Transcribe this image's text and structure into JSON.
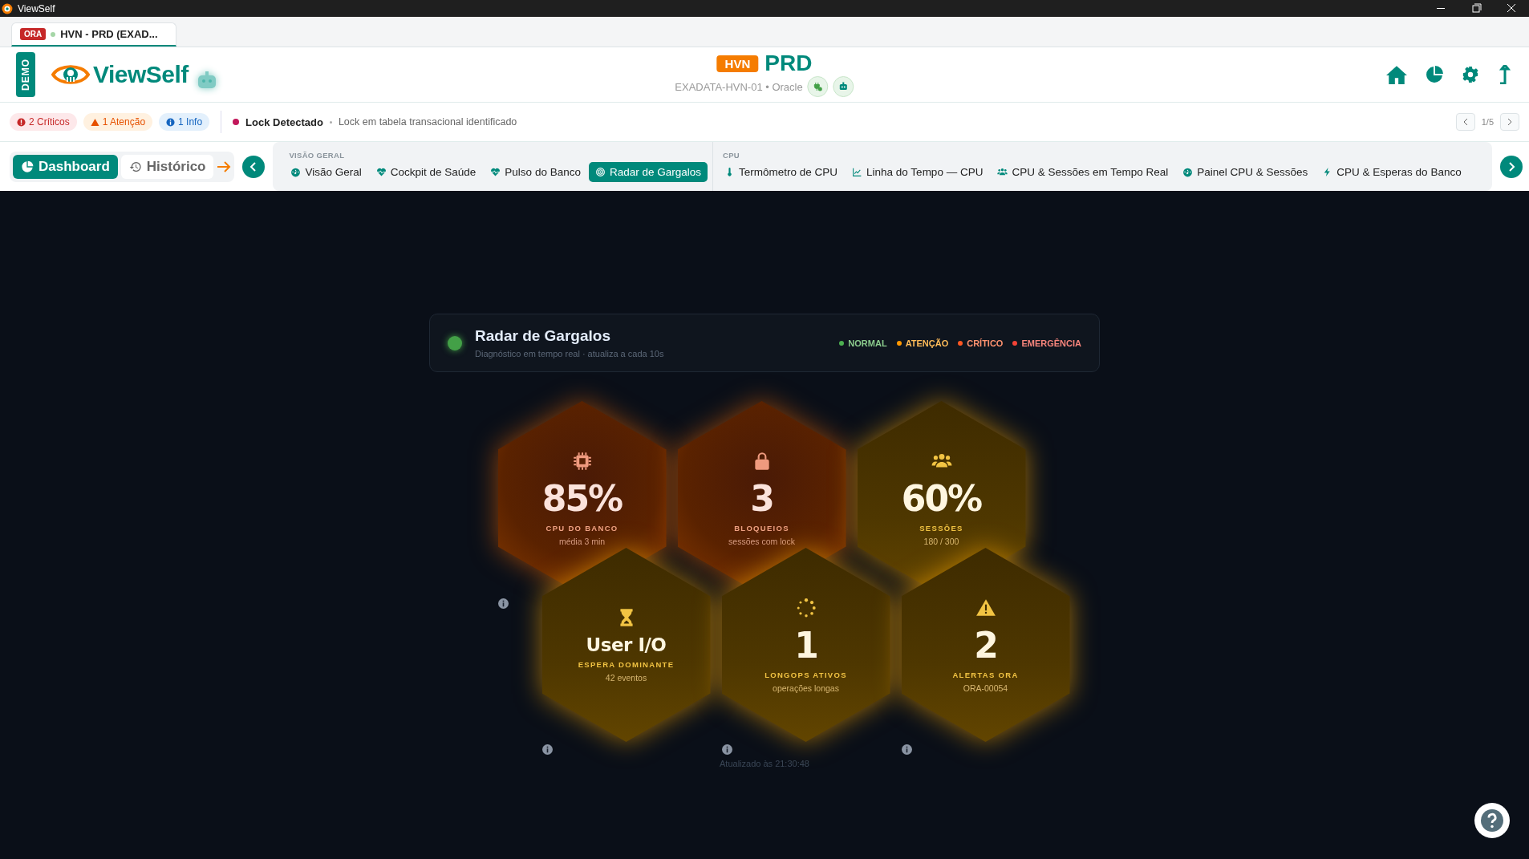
{
  "window": {
    "title": "ViewSelf"
  },
  "tabs": [
    {
      "badge": "ORA",
      "label": "HVN - PRD (EXAD...",
      "selected": true
    }
  ],
  "header": {
    "demo_badge": "DEMO",
    "logo_text": "ViewSelf",
    "env_badge": "HVN",
    "env_name": "PRD",
    "subtitle": "EXADATA-HVN-01 • Oracle"
  },
  "alerts": {
    "counts": [
      {
        "kind": "critical",
        "label": "2 Críticos"
      },
      {
        "kind": "warning",
        "label": "1 Atenção"
      },
      {
        "kind": "info",
        "label": "1 Info"
      }
    ],
    "message": {
      "color": "#c2185b",
      "title": "Lock Detectado",
      "detail": "Lock em tabela transacional identificado"
    },
    "pager": "1/5"
  },
  "nav": {
    "modes": [
      {
        "kind": "dashboard",
        "label": "Dashboard",
        "selected": true
      },
      {
        "kind": "history",
        "label": "Histórico",
        "selected": false
      }
    ],
    "groups": [
      {
        "title": "VISÃO GERAL",
        "items": [
          {
            "kind": "gauge",
            "label": "Visão Geral",
            "selected": false
          },
          {
            "kind": "heart",
            "label": "Cockpit de Saúde",
            "selected": false
          },
          {
            "kind": "heart",
            "label": "Pulso do Banco",
            "selected": false
          },
          {
            "kind": "target",
            "label": "Radar de Gargalos",
            "selected": true
          }
        ]
      },
      {
        "title": "CPU",
        "items": [
          {
            "kind": "thermometer",
            "label": "Termômetro de CPU",
            "selected": false
          },
          {
            "kind": "linechart",
            "label": "Linha do Tempo — CPU",
            "selected": false
          },
          {
            "kind": "users",
            "label": "CPU & Sessões em Tempo Real",
            "selected": false
          },
          {
            "kind": "gauge",
            "label": "Painel CPU & Sessões",
            "selected": false
          },
          {
            "kind": "bolt",
            "label": "CPU & Esperas do Banco",
            "selected": false
          }
        ]
      }
    ]
  },
  "panel": {
    "title": "Radar de Gargalos",
    "subtitle": "Diagnóstico em tempo real · atualiza a cada 10s",
    "legend": [
      {
        "label": "NORMAL",
        "color": "#4caf50"
      },
      {
        "label": "ATENÇÃO",
        "color": "#ff9800"
      },
      {
        "label": "CRÍTICO",
        "color": "#ff5722"
      },
      {
        "label": "EMERGÊNCIA",
        "color": "#f44336"
      }
    ]
  },
  "cells": [
    {
      "kind": "cpu",
      "critical": true,
      "value": "85%",
      "label": "CPU DO BANCO",
      "detail": "média 3 min"
    },
    {
      "kind": "lock",
      "critical": true,
      "value": "3",
      "label": "BLOQUEIOS",
      "detail": "sessões com lock"
    },
    {
      "kind": "users",
      "critical": false,
      "value": "60%",
      "label": "SESSÕES",
      "detail": "180 / 300"
    },
    {
      "kind": "hourglass",
      "critical": false,
      "value": "User I/O",
      "label": "ESPERA DOMINANTE",
      "detail": "42 eventos"
    },
    {
      "kind": "spinner",
      "critical": false,
      "value": "1",
      "label": "LONGOPS ATIVOS",
      "detail": "operações longas"
    },
    {
      "kind": "alert",
      "critical": false,
      "value": "2",
      "label": "ALERTAS ORA",
      "detail": "ORA-00054"
    }
  ],
  "updated": "Atualizado às 21:30:48"
}
